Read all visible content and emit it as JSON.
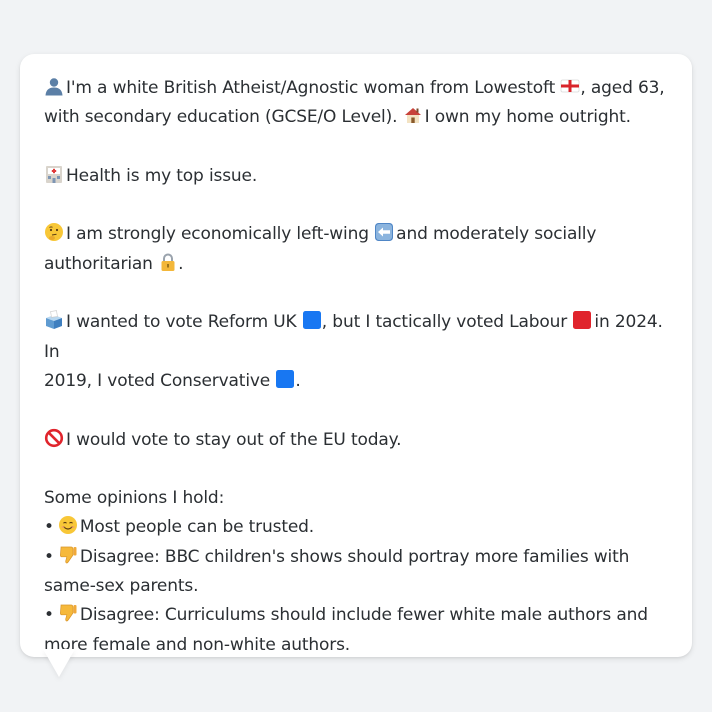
{
  "profile": {
    "intro_line1": "I'm a white British Atheist/Agnostic woman from Lowestoft",
    "intro_line1b": ", aged 63,",
    "intro_line2a": "with secondary education (GCSE/O Level).",
    "intro_line2b": "I own my home outright.",
    "health": "Health is my top issue.",
    "politics_a": "I am strongly economically left-wing",
    "politics_b": "and moderately socially",
    "politics_c": "authoritarian",
    "politics_d": ".",
    "vote_a": "I wanted to vote Reform UK",
    "vote_b": ", but I tactically voted Labour",
    "vote_c": "in 2024. In",
    "vote_d": "2019, I voted Conservative",
    "vote_e": ".",
    "eu": "I would vote to stay out of the EU today.",
    "opinions_heading": "Some opinions I hold:",
    "opinions": [
      {
        "bullet": "•",
        "icon": "smile-icon",
        "text": "Most people can be trusted."
      },
      {
        "bullet": "•",
        "icon": "thumbs-down-icon",
        "text_a": "Disagree: BBC children's shows should portray more families with",
        "text_b": "same-sex parents."
      },
      {
        "bullet": "•",
        "icon": "thumbs-down-icon",
        "text_a": "Disagree: Curriculums should include fewer white male authors and",
        "text_b": "more female and non-white authors."
      }
    ]
  },
  "icons": {
    "person": "person-silhouette-icon",
    "flag": "england-flag-icon",
    "house": "house-icon",
    "hospital": "hospital-icon",
    "thinking": "thinking-face-icon",
    "left_arrow": "left-arrow-icon",
    "lock": "lock-icon",
    "ballot": "ballot-box-icon",
    "reform_square": "blue-square-icon",
    "labour_square": "red-square-icon",
    "conservative_square": "blue-square-icon",
    "prohibited": "prohibited-icon"
  },
  "colors": {
    "background": "#f1f3f5",
    "bubble": "#ffffff",
    "text": "#2b2f33",
    "reform": "#1877f2",
    "labour": "#e0242c",
    "conservative": "#1877f2"
  }
}
